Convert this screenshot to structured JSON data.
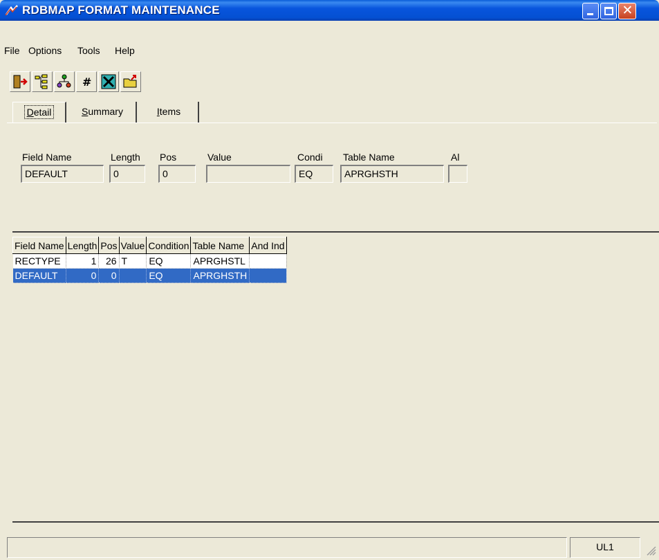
{
  "window": {
    "title": "RDBMAP FORMAT MAINTENANCE",
    "close_glyph": "✕"
  },
  "menu": [
    "File",
    "Options",
    "Tools",
    "Help"
  ],
  "toolbar": [
    "exit-icon",
    "tree-icon",
    "hierarchy-icon",
    "number-icon",
    "tools-icon",
    "folder-open-icon"
  ],
  "tabs": [
    {
      "prefix": "",
      "accel": "D",
      "rest": "etail"
    },
    {
      "prefix": "",
      "accel": "S",
      "rest": "ummary"
    },
    {
      "prefix": "",
      "accel": "I",
      "rest": "tems"
    }
  ],
  "detail": {
    "labels": {
      "field_name": "Field Name",
      "length": "Length",
      "pos": "Pos",
      "value": "Value",
      "condition": "Condi",
      "table_name": "Table Name",
      "and_ind": "Al"
    },
    "values": {
      "field_name": "DEFAULT",
      "length": "0",
      "pos": "0",
      "value": "",
      "condition": "EQ",
      "table_name": "APRGHSTH",
      "and_ind": ""
    }
  },
  "list": {
    "columns": [
      "Field Name",
      "Length",
      "Pos",
      "Value",
      "Condition",
      "Table Name",
      "And Ind"
    ],
    "rows": [
      {
        "field_name": "RECTYPE",
        "length": "1",
        "pos": "26",
        "value": "T",
        "condition": "EQ",
        "table_name": "APRGHSTL",
        "and_ind": ""
      },
      {
        "field_name": "DEFAULT",
        "length": "0",
        "pos": "0",
        "value": "",
        "condition": "EQ",
        "table_name": "APRGHSTH",
        "and_ind": ""
      }
    ],
    "selected_row": 1
  },
  "status": {
    "pane1": "",
    "pane2": "UL1"
  },
  "colors": {
    "titlebar": "#0A5DD8",
    "selection": "#316AC5",
    "face": "#ECE9D8"
  }
}
